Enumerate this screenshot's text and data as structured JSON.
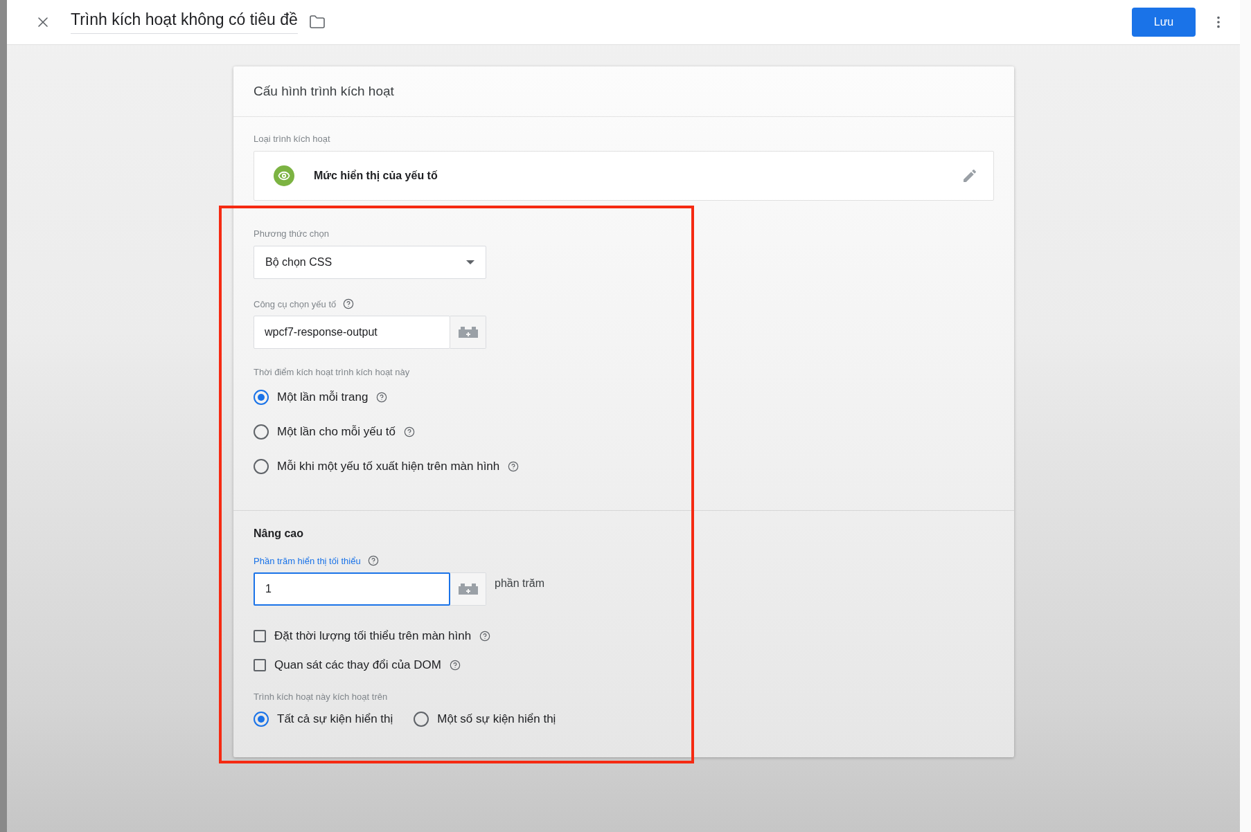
{
  "header": {
    "title": "Trình kích hoạt không có tiêu đề",
    "save_button": "Lưu"
  },
  "card": {
    "title": "Cấu hình trình kích hoạt",
    "trigger_type": {
      "label": "Loại trình kích hoạt",
      "value": "Mức hiển thị của yếu tố"
    },
    "selection_method": {
      "label": "Phương thức chọn",
      "value": "Bộ chọn CSS"
    },
    "element_selector": {
      "label": "Công cụ chọn yếu tố",
      "value": "wpcf7-response-output"
    },
    "fire_timing": {
      "label": "Thời điểm kích hoạt trình kích hoạt này",
      "options": [
        {
          "label": "Một lần mỗi trang",
          "selected": true
        },
        {
          "label": "Một lần cho mỗi yếu tố",
          "selected": false
        },
        {
          "label": "Mỗi khi một yếu tố xuất hiện trên màn hình",
          "selected": false
        }
      ]
    },
    "advanced": {
      "title": "Nâng cao",
      "min_percent": {
        "label": "Phần trăm hiển thị tối thiểu",
        "value": "1",
        "unit": "phần trăm",
        "focused": true
      },
      "checkboxes": [
        {
          "label": "Đặt thời lượng tối thiểu trên màn hình",
          "checked": false
        },
        {
          "label": "Quan sát các thay đổi của DOM",
          "checked": false
        }
      ],
      "fire_on": {
        "label": "Trình kích hoạt này kích hoạt trên",
        "options": [
          {
            "label": "Tất cả sự kiện hiển thị",
            "selected": true
          },
          {
            "label": "Một số sự kiện hiển thị",
            "selected": false
          }
        ]
      }
    }
  }
}
